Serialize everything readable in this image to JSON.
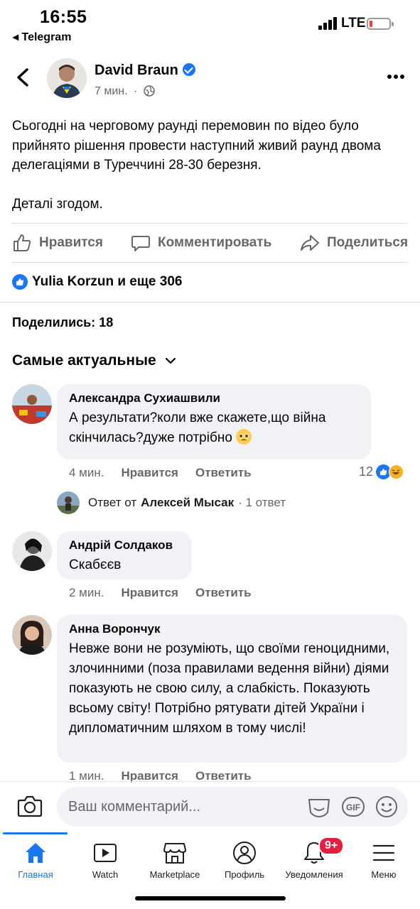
{
  "status_bar": {
    "time": "16:55",
    "back_app": "◂ Telegram",
    "network": "LTE"
  },
  "post": {
    "author": "David Braun",
    "verified": true,
    "time_ago": "7 мин.",
    "dot": "·",
    "paragraphs": [
      "Сьогодні на черговому раунді перемовин по відео було прийнято рішення провести наступний живий раунд двома делегаціями в Туреччині 28-30 березня.",
      "Деталі згодом."
    ]
  },
  "actions": {
    "like": "Нравится",
    "comment": "Комментировать",
    "share": "Поделиться"
  },
  "reactions_summary": "Yulia Korzun и еще 306",
  "shares_count": "Поделились: 18",
  "sort_label": "Самые актуальные",
  "comments": [
    {
      "name": "Александра Сухиашвили",
      "text": "А результати?коли вже скажете,що війна скінчилась?дуже потрібно",
      "time": "4 мин.",
      "like": "Нравится",
      "reply": "Ответить",
      "reaction_count": "12"
    },
    {
      "name": "Андрій Солдаков",
      "text": "Скабєєв",
      "time": "2 мин.",
      "like": "Нравится",
      "reply": "Ответить"
    },
    {
      "name": "Анна Ворончук",
      "text": "Невже вони не розуміють, що своїми геноцидними, злочинними (поза правилами ведення війни) діями показують не свою силу, а слабкість. Показують всьому світу! Потрібно рятувати дітей України і дипломатичним шляхом в тому числі!",
      "time": "1 мин.",
      "like": "Нравится",
      "reply": "Ответить"
    }
  ],
  "reply_thread": {
    "prefix": "Ответ от",
    "name": "Алексей Мысак",
    "count": "· 1 ответ"
  },
  "composer": {
    "placeholder": "Ваш комментарий..."
  },
  "tabs": [
    {
      "label": "Главная",
      "icon": "home-icon"
    },
    {
      "label": "Watch",
      "icon": "watch-icon"
    },
    {
      "label": "Marketplace",
      "icon": "marketplace-icon"
    },
    {
      "label": "Профиль",
      "icon": "profile-icon"
    },
    {
      "label": "Уведомления",
      "icon": "bell-icon"
    },
    {
      "label": "Меню",
      "icon": "menu-icon"
    }
  ],
  "notifications_badge": "9+",
  "colors": {
    "accent": "#1877f2",
    "badge": "#e41e3f",
    "secondary_text": "#65676b",
    "bubble": "#f0f2f5"
  }
}
